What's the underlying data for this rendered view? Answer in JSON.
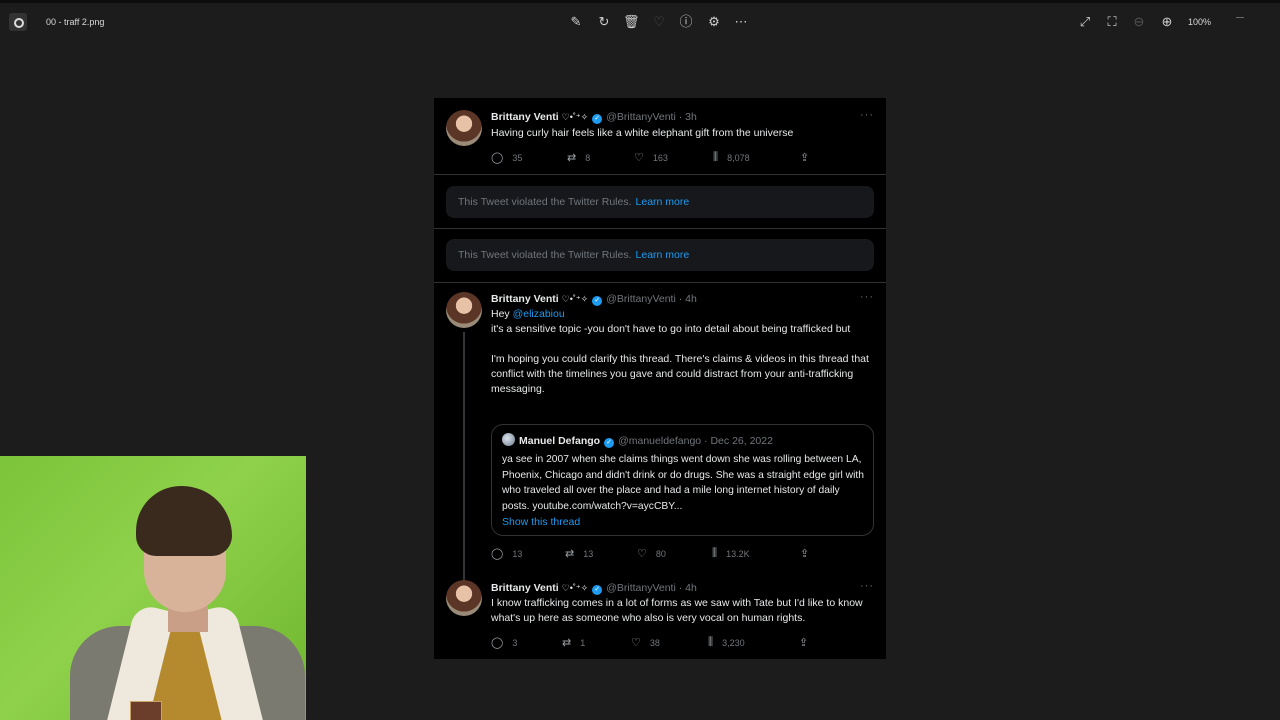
{
  "viewer": {
    "file_name": "00 - traff 2.png",
    "zoom": "100%",
    "toolbar_icons": [
      "edit-icon",
      "rotate-icon",
      "delete-icon",
      "favorite-icon",
      "info-icon",
      "adjust-icon",
      "more-icon"
    ],
    "right_icons": [
      "fullscreen-icon",
      "crop-icon",
      "zoom-out-icon",
      "zoom-in-icon"
    ]
  },
  "tweets": [
    {
      "name": "Brittany Venti",
      "emoji": "♡•˚⁺✧",
      "handle": "@BrittanyVenti · 3h",
      "text": "Having curly hair feels like a white elephant gift from the universe",
      "replies": "35",
      "retweets": "8",
      "likes": "163",
      "views": "8,078"
    },
    {
      "name": "Brittany Venti",
      "emoji": "♡•˚⁺✧",
      "handle": "@BrittanyVenti · 4h",
      "text_prefix": "Hey ",
      "mention": "@elizabiou",
      "text": "it's a sensitive topic -you don't have to go into detail about being trafficked but\n\nI'm hoping you could clarify this thread. There's claims & videos in this thread that conflict with the timelines you gave and could distract from your anti-trafficking messaging.",
      "replies": "13",
      "retweets": "13",
      "likes": "80",
      "views": "13.2K"
    },
    {
      "name": "Brittany Venti",
      "emoji": "♡•˚⁺✧",
      "handle": "@BrittanyVenti · 4h",
      "text": "I know trafficking comes in a lot of forms as we saw with Tate but I'd like to know what's up here as someone who also is very vocal on human rights.",
      "replies": "3",
      "retweets": "1",
      "likes": "38",
      "views": "3,230"
    }
  ],
  "violations": [
    {
      "text": "This Tweet violated the Twitter Rules.",
      "link": "Learn more"
    },
    {
      "text": "This Tweet violated the Twitter Rules.",
      "link": "Learn more"
    }
  ],
  "quote": {
    "name": "Manuel Defango",
    "handle": "@manueldefango · Dec 26, 2022",
    "text": "ya see in 2007 when she claims things went down she was rolling between LA, Phoenix, Chicago and didn't drink or do drugs. She was a straight edge girl with who traveled all over the place and had a mile long internet history of daily posts. youtube.com/watch?v=aycCBY...",
    "show_thread": "Show this thread"
  },
  "icons": {
    "reply": "reply-icon",
    "retweet": "retweet-icon",
    "like": "like-icon",
    "views": "views-icon",
    "share": "share-icon",
    "more": "more-icon",
    "verified": "verified-icon"
  },
  "colors": {
    "accent": "#1d9bf0",
    "background": "#1c1c1c",
    "tweet_bg": "#000000",
    "muted": "#71767b"
  }
}
